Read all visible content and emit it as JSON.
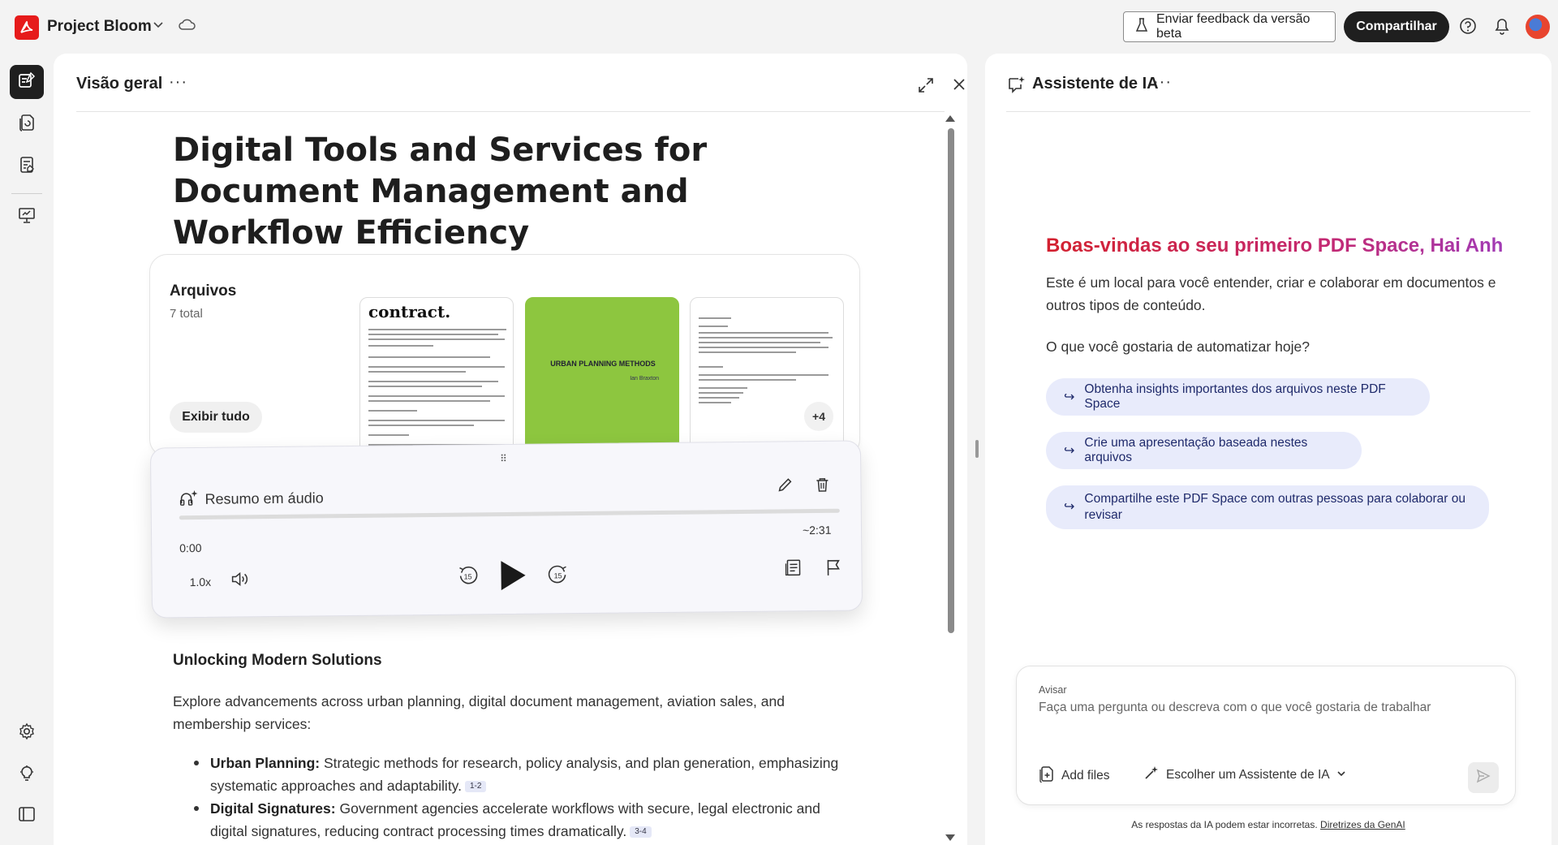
{
  "app": {
    "title": "Project Bloom",
    "brand_color": "#e61b1b"
  },
  "topbar": {
    "feedback_label": "Enviar feedback da versão beta",
    "share_label": "Compartilhar",
    "icons": [
      "chevron-down-icon",
      "cloud-icon",
      "flask-icon",
      "help-icon",
      "bell-icon"
    ]
  },
  "rail": {
    "items": [
      "overview-icon",
      "files-icon",
      "notes-icon",
      "presentation-icon",
      "settings-icon",
      "lightbulb-icon",
      "panel-toggle-icon"
    ]
  },
  "overview": {
    "header_title": "Visão geral",
    "more": "···",
    "doc_title": "Digital Tools and Services for Document Management and Workflow Efficiency",
    "files": {
      "label": "Arquivos",
      "count": "7 total",
      "show_all": "Exibir tudo",
      "more_badge": "+4",
      "thumb1_title": "contract.",
      "thumb2_title": "URBAN PLANNING METHODS",
      "thumb2_sub": "Ian Braxton",
      "thumb2_color": "#8dc63f"
    },
    "audio": {
      "label": "Resumo em áudio",
      "time_start": "0:00",
      "time_end": "~2:31",
      "progress": 0,
      "speed": "1.0x",
      "rewind_seconds": "15",
      "forward_seconds": "15"
    },
    "section_heading": "Unlocking Modern Solutions",
    "intro": "Explore advancements across urban planning, digital document management, aviation sales, and membership services:",
    "bullets": [
      {
        "term": "Urban Planning:",
        "text": " Strategic methods for research, policy analysis, and plan generation, emphasizing systematic approaches and adaptability.",
        "cite": "1-2"
      },
      {
        "term": "Digital Signatures:",
        "text": " Government agencies accelerate workflows with secure, legal electronic and digital signatures, reducing contract processing times dramatically.",
        "cite": "3-4"
      }
    ]
  },
  "assistant": {
    "header_title": "Assistente de IA",
    "more": "···",
    "welcome_title": "Boas-vindas ao seu primeiro PDF Space, Hai Anh",
    "welcome_desc": "Este é um local para você entender, criar e colaborar em documentos e outros tipos de conteúdo.",
    "question": "O que você gostaria de automatizar hoje?",
    "suggestions": [
      "Obtenha insights importantes dos arquivos neste PDF Space",
      "Crie uma apresentação baseada nestes arquivos",
      "Compartilhe este PDF Space com outras pessoas para colaborar ou revisar"
    ],
    "prompt_label": "Avisar",
    "prompt_placeholder": "Faça uma pergunta ou descreva com o que você gostaria de trabalhar",
    "add_files": "Add files",
    "chooser": "Escolher um Assistente de IA",
    "disclaimer": "As respostas da IA podem estar incorretas.",
    "disclaimer_link": "Diretrizes da GenAI",
    "welcome_gradient": [
      "#d3212f",
      "#c42870",
      "#a23bb5"
    ],
    "suggestion_bg": "#e8ebfb"
  }
}
